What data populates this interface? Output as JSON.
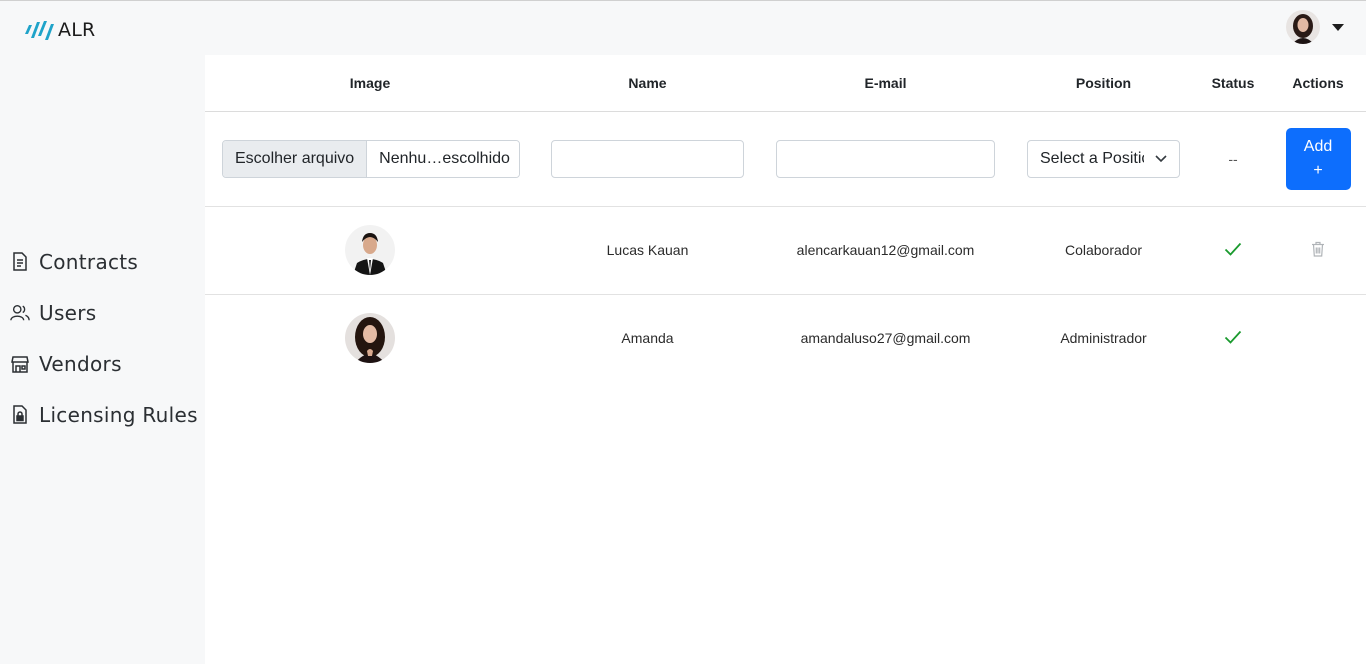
{
  "app": {
    "logo_text": "ALR",
    "brand_color": "#1fa3c9"
  },
  "sidebar": {
    "items": [
      {
        "label": "Contracts",
        "icon": "document-icon"
      },
      {
        "label": "Users",
        "icon": "users-icon"
      },
      {
        "label": "Vendors",
        "icon": "store-icon"
      },
      {
        "label": "Licensing Rules",
        "icon": "file-lock-icon"
      }
    ]
  },
  "table": {
    "headers": [
      "Image",
      "Name",
      "E-mail",
      "Position",
      "Status",
      "Actions"
    ],
    "form": {
      "file_button": "Escolher arquivo",
      "file_name": "Nenhu…escolhido",
      "name_value": "",
      "email_value": "",
      "position_selected": "Select a Position",
      "status": "--",
      "add_label": "Add",
      "add_plus": "+"
    },
    "rows": [
      {
        "name": "Lucas Kauan",
        "email": "alencarkauan12@gmail.com",
        "position": "Colaborador",
        "status_icon": "check-icon",
        "action_icon": "trash-icon"
      },
      {
        "name": "Amanda",
        "email": "amandaluso27@gmail.com",
        "position": "Administrador",
        "status_icon": "check-icon",
        "action_icon": ""
      }
    ]
  },
  "colors": {
    "accent": "#0d6efd",
    "status_ok": "#1a9a2e"
  }
}
